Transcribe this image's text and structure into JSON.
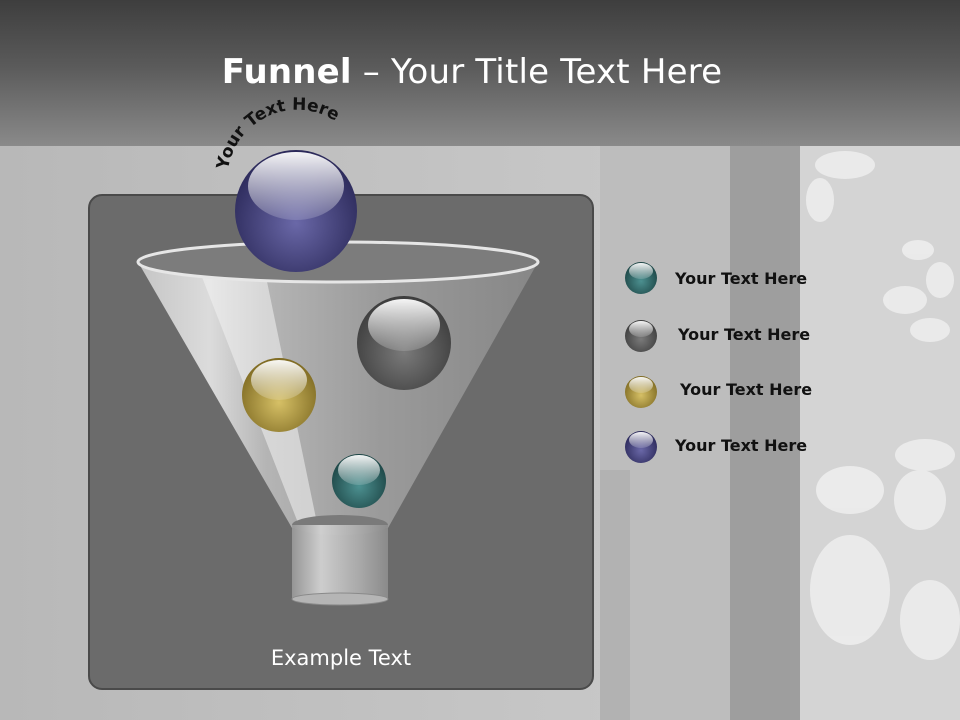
{
  "header": {
    "title_bold": "Funnel",
    "title_rest": " – Your Title Text Here"
  },
  "diagram": {
    "arc_text": "Your Text Here",
    "example_text": "Example Text",
    "legend": [
      {
        "label": "Your  Text Here",
        "color": "#2f6b6b"
      },
      {
        "label": "Your  Text Here",
        "color": "#5a5a5a"
      },
      {
        "label": "Your  Text Here",
        "color": "#9c8a3a"
      },
      {
        "label": "Your  Text Here",
        "color": "#3c3a6e"
      }
    ]
  },
  "colors": {
    "top_ball": "#3c3a6e",
    "gray_ball": "#5a5a5a",
    "gold_ball": "#9c8a3a",
    "teal_ball": "#2f6b6b"
  }
}
